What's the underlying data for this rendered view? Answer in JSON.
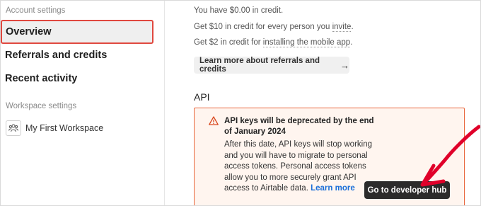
{
  "sidebar": {
    "account_section_label": "Account settings",
    "items": [
      {
        "label": "Overview",
        "active": true
      },
      {
        "label": "Referrals and credits",
        "active": false
      },
      {
        "label": "Recent activity",
        "active": false
      }
    ],
    "workspace_section_label": "Workspace settings",
    "workspace": {
      "label": "My First Workspace",
      "icon": "people-group-icon"
    }
  },
  "credits": {
    "balance_text": "You have $0.00 in credit.",
    "invite_prefix": "Get $10 in credit for every person you ",
    "invite_link": "invite",
    "invite_suffix": ".",
    "mobile_prefix": "Get $2 in credit for ",
    "mobile_link": "installing the mobile app",
    "mobile_suffix": ".",
    "learn_more_button": "Learn more about referrals and credits",
    "learn_more_icon": "arrow-right-icon"
  },
  "api": {
    "heading": "API",
    "alert": {
      "icon": "warning-triangle-icon",
      "title": "API keys will be deprecated by the end of January 2024",
      "body": "After this date, API keys will stop working and you will have to migrate to personal access tokens. Personal access tokens allow you to more securely grant API access to Airtable data.",
      "link": "Learn more",
      "border_color": "#e8643a",
      "background_color": "#fff5ef"
    },
    "developer_hub_button": "Go to developer hub"
  },
  "annotations": {
    "highlight_color": "#e0483f",
    "arrow_color": "#e0002a"
  }
}
